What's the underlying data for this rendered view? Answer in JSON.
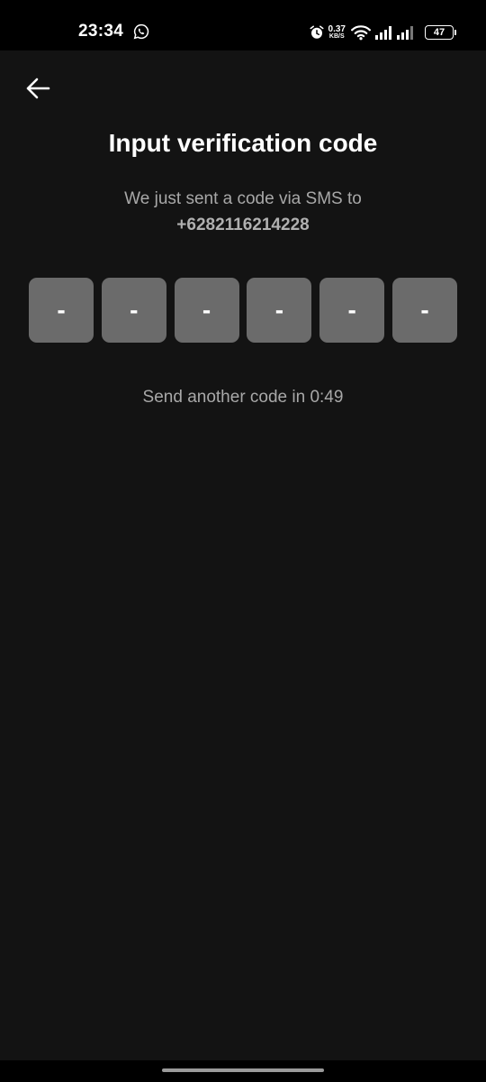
{
  "status_bar": {
    "time": "23:34",
    "net_speed_value": "0.37",
    "net_speed_unit": "KB/S",
    "battery_level": "47",
    "icons": [
      "whatsapp-icon",
      "alarm-icon",
      "wifi-icon",
      "signal-icon",
      "signal-icon",
      "battery-icon"
    ]
  },
  "header": {
    "back_icon": "arrow-left-icon"
  },
  "main": {
    "title": "Input verification code",
    "subtitle_line1": "We just sent a code via SMS to",
    "phone_number": "+6282116214228",
    "code_boxes": [
      "-",
      "-",
      "-",
      "-",
      "-",
      "-"
    ],
    "resend_text": "Send another code in 0:49"
  },
  "colors": {
    "background": "#131313",
    "code_box": "#6b6b6b",
    "secondary_text": "#a8a8a8"
  }
}
